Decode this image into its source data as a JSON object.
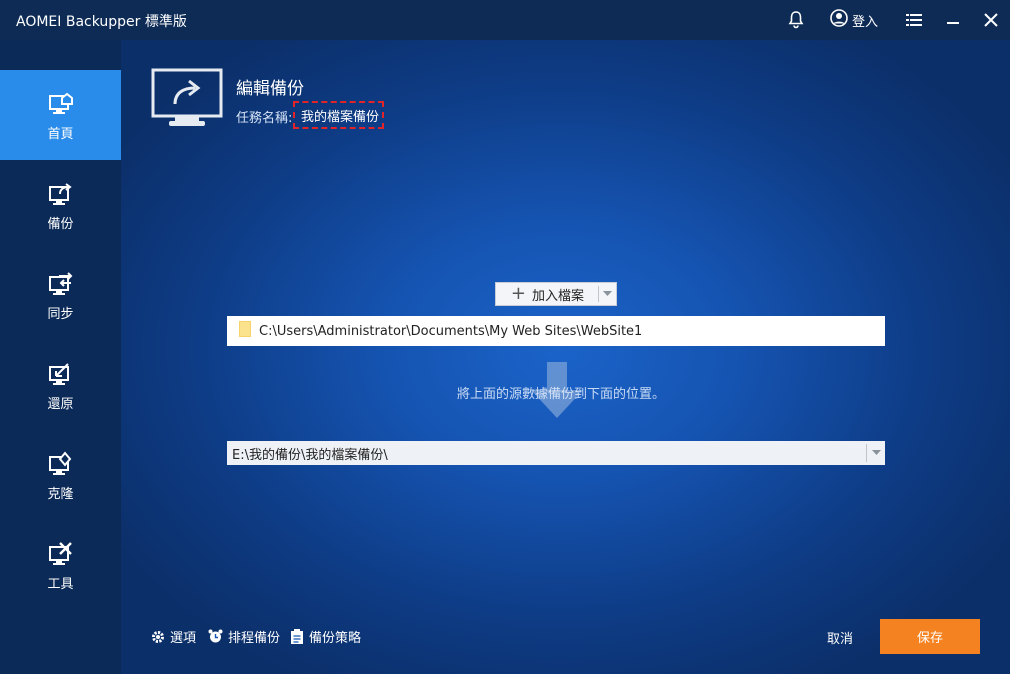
{
  "app": {
    "title": "AOMEI Backupper 標準版",
    "login_label": "登入"
  },
  "sidebar": {
    "items": [
      {
        "label": "首頁",
        "icon": "home-monitor-icon",
        "active": true
      },
      {
        "label": "備份",
        "icon": "backup-icon",
        "active": false
      },
      {
        "label": "同步",
        "icon": "sync-icon",
        "active": false
      },
      {
        "label": "還原",
        "icon": "restore-icon",
        "active": false
      },
      {
        "label": "克隆",
        "icon": "clone-icon",
        "active": false
      },
      {
        "label": "工具",
        "icon": "tools-icon",
        "active": false
      }
    ]
  },
  "main": {
    "title": "編輯備份",
    "task_name_label": "任務名稱:",
    "task_name_value": "我的檔案備份",
    "add_file_label": "加入檔案",
    "source_path": "C:\\Users\\Administrator\\Documents\\My Web Sites\\WebSite1",
    "hint": "將上面的源數據備份到下面的位置。",
    "destination_path": "E:\\我的備份\\我的檔案備份\\"
  },
  "footer": {
    "options_label": "選項",
    "schedule_label": "排程備份",
    "scheme_label": "備份策略",
    "cancel_label": "取消",
    "save_label": "保存"
  },
  "colors": {
    "accent": "#2a8cea",
    "save": "#f58220",
    "warning_border": "#e0242a",
    "folder": "#f6d36b"
  }
}
